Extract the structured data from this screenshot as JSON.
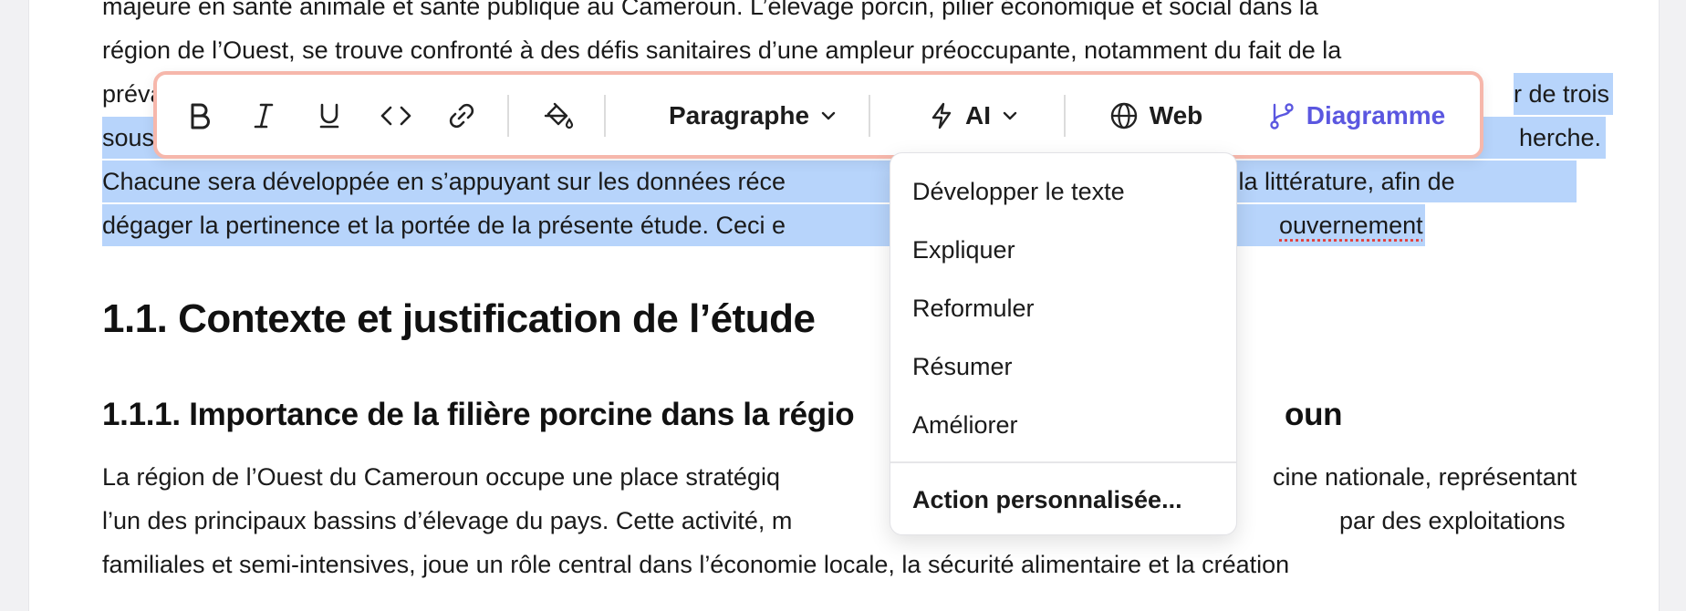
{
  "document": {
    "lines": [
      {
        "segments": [
          {
            "text": "majeure en santé animale et santé publique au Cameroun. L’élevage porcin, pilier économique et social dans la",
            "hl": false
          }
        ]
      },
      {
        "segments": [
          {
            "text": "région de l’Ouest, se trouve confronté à des défis sanitaires d’une ampleur préoccupante, notamment du fait de la",
            "hl": false
          }
        ]
      },
      {
        "segments": [
          {
            "text": "préval",
            "hl": false
          },
          {
            "text": "                                                                                                                                         ",
            "hl": false
          },
          {
            "text": "r de trois",
            "hl": true
          }
        ]
      },
      {
        "segments": [
          {
            "text": "sous-s",
            "hl": true
          },
          {
            "text": "                                                                                                                                            ",
            "hl": true
          },
          {
            "text": "herche.",
            "hl": true
          }
        ]
      },
      {
        "segments": [
          {
            "text": "Chacune sera développée en s’appuyant sur les données réce",
            "hl": true
          }
        ]
      },
      {
        "segments": [
          {
            "text": "dégager la pertinence et la portée de la présente étude. Ceci e",
            "hl": true
          }
        ]
      }
    ],
    "line3_right": "de la littérature, afin de",
    "line4_right": "ouvernement",
    "heading_1": "1.1. Contexte et justification de l’étude",
    "heading_2_left": "1.1.1. Importance de la filière porcine dans la régio",
    "heading_2_right": "oun",
    "body_lines": [
      {
        "left": "La région de l’Ouest du Cameroun occupe une place stratégiq",
        "right": "cine nationale, représentant"
      },
      {
        "left": "l’un des principaux bassins d’élevage du pays. Cette activité, m",
        "right": "par des exploitations"
      },
      {
        "left": "familiales et semi-intensives, joue un rôle central dans l’économie locale, la sécurité alimentaire et la création",
        "right": ""
      }
    ]
  },
  "toolbar": {
    "paragraph_label": "Paragraphe",
    "ai_label": "AI",
    "web_label": "Web",
    "diagram_label": "Diagramme",
    "accent_color": "#5b57e0",
    "icons": [
      "bold-icon",
      "italic-icon",
      "underline-icon",
      "code-icon",
      "link-icon",
      "paint-bucket-icon",
      "chevron-down-icon",
      "lightning-icon",
      "globe-icon",
      "branch-icon"
    ]
  },
  "ai_menu": {
    "items": [
      "Développer le texte",
      "Expliquer",
      "Reformuler",
      "Résumer",
      "Améliorer"
    ],
    "custom_action": "Action personnalisée..."
  }
}
